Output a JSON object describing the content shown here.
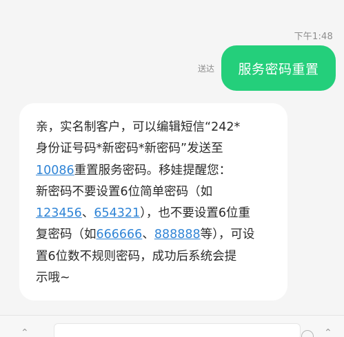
{
  "thread": {
    "timestamp": "下午1:48"
  },
  "sent_message": {
    "status": "送达",
    "text": "服务密码重置"
  },
  "received_message": {
    "segments": [
      {
        "text": "亲，实名制客户，可以编辑短信“242*",
        "link": false,
        "newline": true
      },
      {
        "text": "身份证号码*新密码*新密码”发送至",
        "link": false,
        "newline": true
      },
      {
        "text": "10086",
        "link": true,
        "newline": false
      },
      {
        "text": "重置服务密码。移娃提醒您：",
        "link": false,
        "newline": true
      },
      {
        "text": "新密码不要设置6位简单密码（如",
        "link": false,
        "newline": true
      },
      {
        "text": "123456",
        "link": true,
        "newline": false
      },
      {
        "text": "、",
        "link": false,
        "newline": false
      },
      {
        "text": "654321",
        "link": true,
        "newline": false
      },
      {
        "text": "），也不要设置6位重",
        "link": false,
        "newline": true
      },
      {
        "text": "复密码（如",
        "link": false,
        "newline": false
      },
      {
        "text": "666666",
        "link": true,
        "newline": false
      },
      {
        "text": "、",
        "link": false,
        "newline": false
      },
      {
        "text": "888888",
        "link": true,
        "newline": false
      },
      {
        "text": "等），可设",
        "link": false,
        "newline": true
      },
      {
        "text": "置6位数不规则密码，成功后系统会提",
        "link": false,
        "newline": true
      },
      {
        "text": "示哦~",
        "link": false,
        "newline": true
      }
    ]
  },
  "icons": {
    "left": "chevron-up-icon",
    "emoji": "emoji-icon",
    "right": "expand-icon"
  },
  "colors": {
    "sent_bubble": "#24cf7b",
    "link": "#2f84d6",
    "background": "#f5f5f5"
  }
}
